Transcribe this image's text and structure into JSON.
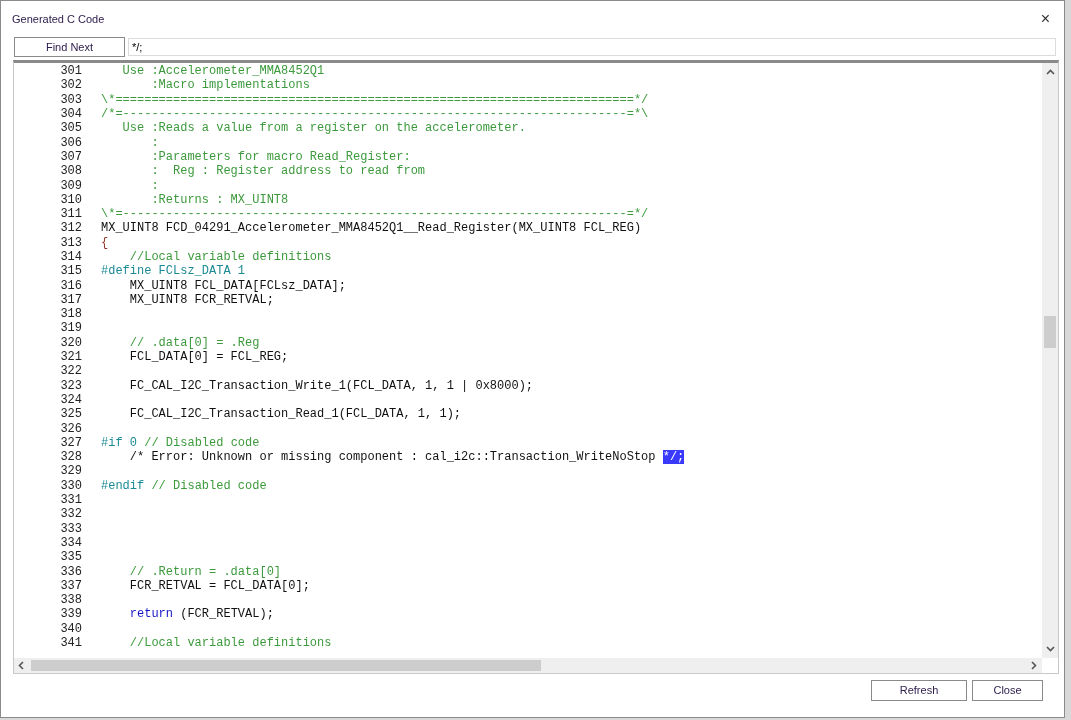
{
  "window": {
    "title": "Generated C Code",
    "close": "×"
  },
  "search": {
    "button": "Find Next",
    "value": "*/;"
  },
  "code": [
    {
      "number": "301",
      "segments": [
        {
          "kind": "comment",
          "text": "   Use :Accelerometer_MMA8452Q1"
        }
      ]
    },
    {
      "number": "302",
      "segments": [
        {
          "kind": "comment",
          "text": "       :Macro implementations"
        }
      ]
    },
    {
      "number": "303",
      "segments": [
        {
          "kind": "comment",
          "text": "\\*========================================================================*/"
        }
      ]
    },
    {
      "number": "304",
      "segments": [
        {
          "kind": "comment",
          "text": "/*=----------------------------------------------------------------------=*\\"
        }
      ]
    },
    {
      "number": "305",
      "segments": [
        {
          "kind": "comment",
          "text": "   Use :Reads a value from a register on the accelerometer."
        }
      ]
    },
    {
      "number": "306",
      "segments": [
        {
          "kind": "comment",
          "text": "       :"
        }
      ]
    },
    {
      "number": "307",
      "segments": [
        {
          "kind": "comment",
          "text": "       :Parameters for macro Read_Register:"
        }
      ]
    },
    {
      "number": "308",
      "segments": [
        {
          "kind": "comment",
          "text": "       :  Reg : Register address to read from"
        }
      ]
    },
    {
      "number": "309",
      "segments": [
        {
          "kind": "comment",
          "text": "       :"
        }
      ]
    },
    {
      "number": "310",
      "segments": [
        {
          "kind": "comment",
          "text": "       :Returns : MX_UINT8"
        }
      ]
    },
    {
      "number": "311",
      "segments": [
        {
          "kind": "comment",
          "text": "\\*=----------------------------------------------------------------------=*/"
        }
      ]
    },
    {
      "number": "312",
      "segments": [
        {
          "kind": "code",
          "text": "MX_UINT8 FCD_04291_Accelerometer_MMA8452Q1__Read_Register(MX_UINT8 FCL_REG)"
        }
      ]
    },
    {
      "number": "313",
      "segments": [
        {
          "kind": "punct",
          "text": "{"
        }
      ]
    },
    {
      "number": "314",
      "segments": [
        {
          "kind": "comment",
          "text": "    //Local variable definitions"
        }
      ]
    },
    {
      "number": "315",
      "segments": [
        {
          "kind": "preproc",
          "text": "#define FCLsz_DATA 1"
        }
      ]
    },
    {
      "number": "316",
      "segments": [
        {
          "kind": "code",
          "text": "    MX_UINT8 FCL_DATA[FCLsz_DATA];"
        }
      ]
    },
    {
      "number": "317",
      "segments": [
        {
          "kind": "code",
          "text": "    MX_UINT8 FCR_RETVAL;"
        }
      ]
    },
    {
      "number": "318"
    },
    {
      "number": "319"
    },
    {
      "number": "320",
      "segments": [
        {
          "kind": "comment",
          "text": "    // .data[0] = .Reg"
        }
      ]
    },
    {
      "number": "321",
      "segments": [
        {
          "kind": "code",
          "text": "    FCL_DATA[0] = FCL_REG;"
        }
      ]
    },
    {
      "number": "322"
    },
    {
      "number": "323",
      "segments": [
        {
          "kind": "code",
          "text": "    FC_CAL_I2C_Transaction_Write_1(FCL_DATA, 1, 1 | 0x8000);"
        }
      ]
    },
    {
      "number": "324"
    },
    {
      "number": "325",
      "segments": [
        {
          "kind": "code",
          "text": "    FC_CAL_I2C_Transaction_Read_1(FCL_DATA, 1, 1);"
        }
      ]
    },
    {
      "number": "326"
    },
    {
      "number": "327",
      "segments": [
        {
          "kind": "preproc",
          "text": "#if 0 "
        },
        {
          "kind": "comment",
          "text": "// Disabled code"
        }
      ]
    },
    {
      "number": "328",
      "segments": [
        {
          "kind": "code",
          "text": "    /* Error: Unknown or missing component : cal_i2c::Transaction_WriteNoStop "
        },
        {
          "kind": "selected",
          "text": "*/;"
        }
      ]
    },
    {
      "number": "329"
    },
    {
      "number": "330",
      "segments": [
        {
          "kind": "preproc",
          "text": "#endif "
        },
        {
          "kind": "comment",
          "text": "// Disabled code"
        }
      ]
    },
    {
      "number": "331"
    },
    {
      "number": "332"
    },
    {
      "number": "333"
    },
    {
      "number": "334"
    },
    {
      "number": "335"
    },
    {
      "number": "336",
      "segments": [
        {
          "kind": "comment",
          "text": "    // .Return = .data[0]"
        }
      ]
    },
    {
      "number": "337",
      "segments": [
        {
          "kind": "code",
          "text": "    FCR_RETVAL = FCL_DATA[0];"
        }
      ]
    },
    {
      "number": "338"
    },
    {
      "number": "339",
      "segments": [
        {
          "kind": "keyword",
          "text": "    return"
        },
        {
          "kind": "code",
          "text": " (FCR_RETVAL);"
        }
      ]
    },
    {
      "number": "340"
    },
    {
      "number": "341",
      "segments": [
        {
          "kind": "comment",
          "text": "    //Local variable definitions"
        }
      ]
    }
  ],
  "buttons": [
    {
      "label": "Refresh"
    },
    {
      "label": "Close"
    }
  ]
}
